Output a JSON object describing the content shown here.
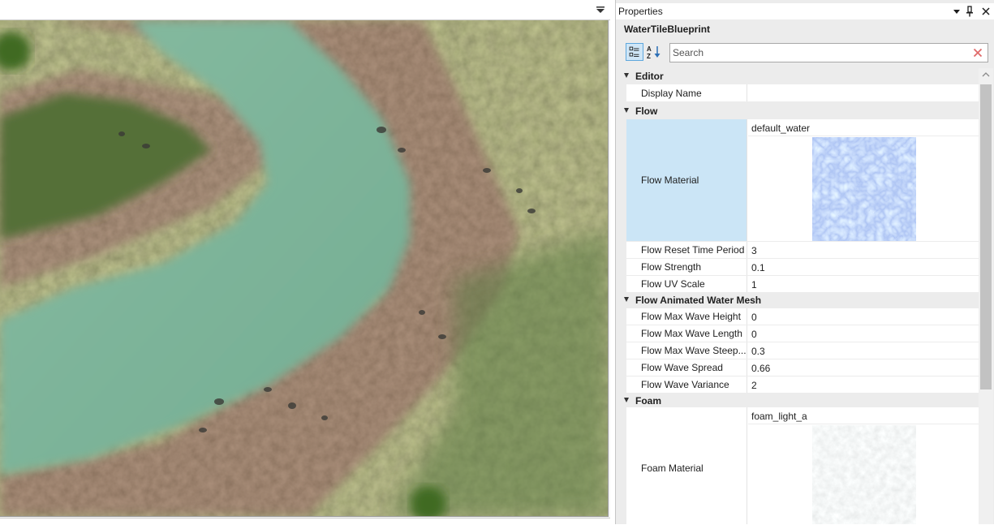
{
  "properties_panel": {
    "title": "Properties",
    "object_name": "WaterTileBlueprint",
    "search": {
      "placeholder": "Search",
      "value": ""
    },
    "categories": [
      {
        "label": "Editor",
        "rows": [
          {
            "name": "Display Name",
            "value": ""
          }
        ]
      },
      {
        "label": "Flow",
        "rows": [
          {
            "name": "Flow Material",
            "value": "default_water"
          },
          {
            "name": "Flow Reset Time Period",
            "value": "3"
          },
          {
            "name": "Flow Strength",
            "value": "0.1"
          },
          {
            "name": "Flow UV Scale",
            "value": "1"
          }
        ]
      },
      {
        "label": "Flow Animated Water Mesh",
        "rows": [
          {
            "name": "Flow Max Wave Height",
            "value": "0"
          },
          {
            "name": "Flow Max Wave Length",
            "value": "0"
          },
          {
            "name": "Flow Max Wave Steep...",
            "value": "0.3"
          },
          {
            "name": "Flow Wave Spread",
            "value": "0.66"
          },
          {
            "name": "Flow Wave Variance",
            "value": "2"
          }
        ]
      },
      {
        "label": "Foam",
        "rows": [
          {
            "name": "Foam Material",
            "value": "foam_light_a"
          }
        ]
      }
    ]
  },
  "colors": {
    "selection": "#cbe5f6",
    "accent": "#5fa8dd",
    "clear_icon": "#e06a6a",
    "water": "#7fb49a",
    "grass": "#4d6a34"
  },
  "icons": {
    "viewport_menu": "dropdown-menu-icon",
    "panel_dropdown": "dropdown-icon",
    "panel_pin": "pin-icon",
    "panel_close": "close-icon",
    "sort_category": "categorized-view-icon",
    "sort_alpha": "alphabetical-sort-icon",
    "search_clear": "clear-search-icon"
  }
}
